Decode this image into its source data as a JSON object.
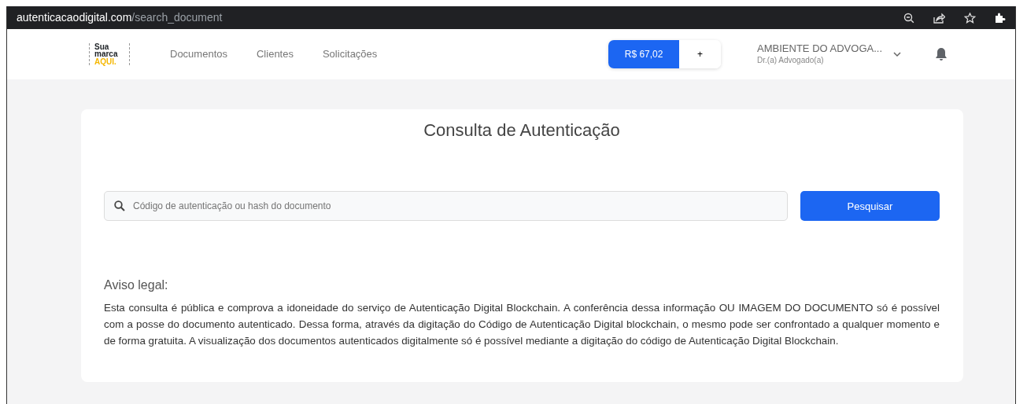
{
  "browser": {
    "url_host": "autenticacaodigital.com",
    "url_path": "/search_document"
  },
  "logo": {
    "line_1": "Sua",
    "line_2": "marca",
    "line_3": "AQUI."
  },
  "nav": [
    {
      "label": "Documentos"
    },
    {
      "label": "Clientes"
    },
    {
      "label": "Solicitações"
    }
  ],
  "balance": {
    "amount": "R$ 67,02",
    "add": "+"
  },
  "account": {
    "name": "AMBIENTE DO ADVOGA...",
    "role": "Dr.(a) Advogado(a)"
  },
  "card": {
    "title": "Consulta de Autenticação",
    "search": {
      "placeholder": "Código de autenticação ou hash do documento"
    },
    "button": "Pesquisar",
    "notice_title": "Aviso legal:",
    "notice": "Esta consulta é pública e comprova a idoneidade do serviço de Autenticação Digital Blockchain. A conferência dessa informação OU IMAGEM DO DOCUMENTO só é possível com a posse do documento autenticado. Dessa forma, através da digitação do Código de Autenticação Digital blockchain, o mesmo pode ser confrontado a qualquer momento e de forma gratuita. A visualização dos documentos autenticados digitalmente só é possível mediante a digitação do código de Autenticação Digital Blockchain."
  }
}
